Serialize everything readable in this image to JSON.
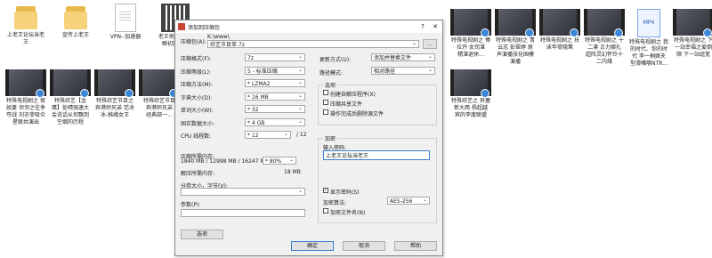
{
  "desktop": {
    "top_row": [
      {
        "kind": "folder",
        "label": "上老王论坛当老\n王"
      },
      {
        "kind": "folder",
        "label": "宣传上老王"
      },
      {
        "kind": "doc",
        "label": "VPN--加速器"
      },
      {
        "kind": "qr",
        "label": "老王地址-永久\n瞬初回到户"
      }
    ],
    "top_row_right": [
      {
        "kind": "video",
        "label": "特殊电视剧之 傅\n拉开·女司湛\n精湛退休..."
      },
      {
        "kind": "video",
        "label": "特殊电视剧之 青\n云志 彭翠婷 原\n声演播张化国模\n演播"
      },
      {
        "kind": "video",
        "label": "特殊电视剧之 扶\n床年荷隐鹭"
      },
      {
        "kind": "video",
        "label": "特殊电视剧之 十\n二凛 古力娜扎\n超阵灵幻怀玲十\n二内煤"
      },
      {
        "kind": "mp4",
        "label": "特殊电视剧之 我\n的时代、你的时\n代 李一桐嫁夫\n型滑嘴嚼NTR..."
      },
      {
        "kind": "video",
        "label": "特殊电视剧之 下\n一站幸福之爱倒\n顺 下一站组宽"
      }
    ],
    "second_row": [
      {
        "kind": "video",
        "label": "特殊电视剧之 夜\n奴婆 邻邻之往争\n夺战 刘亦菲吸众\n星联共演出"
      },
      {
        "kind": "video",
        "label": "特殊综艺【金\n鹰】处晴强速大\n会说话从何飘到\n空烟的历程"
      },
      {
        "kind": "video",
        "label": "特殊综艺节目之\n奔港师兄弟 范冰\n冰-秭峨女王"
      },
      {
        "kind": "video",
        "label": "特殊综艺节目\n奔港师兄弟\n经典部一..."
      }
    ],
    "second_row_right": [
      {
        "kind": "video",
        "label": "特殊综艺之 异塞\n新大两 杨超越\n宾的李度联盟"
      }
    ]
  },
  "dialog": {
    "title": "添加到压缩包",
    "help_glyph": "?",
    "close_glyph": "✕",
    "archive_label": "压缩包(A):",
    "archive_path": "K:\\www\\",
    "archive_name": "综艺节目单.7z",
    "browse_label": "...",
    "left_fields": [
      {
        "label": "压缩格式(F):",
        "value": "7z"
      },
      {
        "label": "压缩等级(L):",
        "value": "5 - 标准压缩"
      },
      {
        "label": "压缩方法(M):",
        "value": "* LZMA2"
      },
      {
        "label": "字典大小(D):",
        "value": "* 16 MB"
      },
      {
        "label": "单词大小(W):",
        "value": "* 32"
      },
      {
        "label": "固实数据大小:",
        "value": "* 4 GB"
      },
      {
        "label": "CPU 线程数:",
        "value": "* 12",
        "suffix": "/ 12"
      }
    ],
    "memory_compress_label": "压缩所需内存:",
    "memory_compress_value": "1840 MB / 12998 MB / 16247 MB",
    "memory_percent": "* 80%",
    "memory_decompress_label": "解压所需内存:",
    "memory_decompress_value": "18 MB",
    "split_label": "分卷大小，字节(V):",
    "params_label": "参数(P):",
    "options_button": "选项",
    "update_label": "更新方式(U):",
    "update_value": "添加并替换文件",
    "path_label": "路径模式:",
    "path_value": "相对路径",
    "options_group_title": "选项",
    "options": [
      {
        "label": "创建自解压程序(X)",
        "checked": false
      },
      {
        "label": "压缩共享文件",
        "checked": false
      },
      {
        "label": "操作完成后删除源文件",
        "checked": false
      }
    ],
    "encrypt_group_title": "加密",
    "password_label": "输入密码:",
    "password_value": "上老王论坛当老王",
    "show_password_label": "显示密码(S)",
    "show_password_checked": true,
    "encrypt_method_label": "加密算法:",
    "encrypt_method_value": "AES-256",
    "encrypt_names_label": "加密文件名(N)",
    "encrypt_names_checked": false,
    "ok_label": "确定",
    "cancel_label": "取消",
    "help_label": "帮助"
  }
}
